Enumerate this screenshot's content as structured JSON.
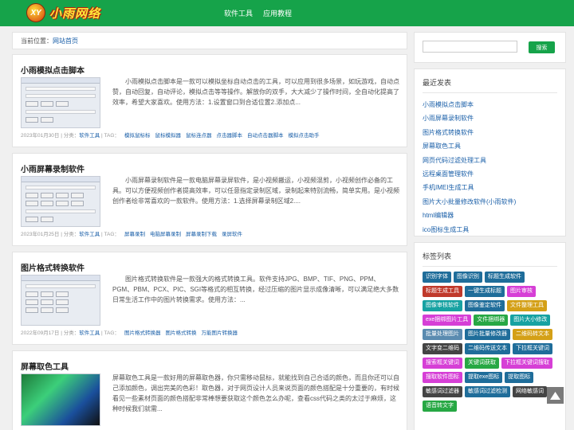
{
  "header": {
    "logo_badge": "XY",
    "logo_text": "小雨网络",
    "nav": [
      "软件工具",
      "应用教程"
    ]
  },
  "breadcrumb": {
    "label": "当前位置：",
    "link": "网站首页"
  },
  "posts": [
    {
      "title": "小雨模拟点击脚本",
      "desc": "小雨模拟点击脚本是一款可以模拟坐标自动点击的工具，可以应用到很多场景，如玩游戏，自动点赞，自动回复，自动评论，模拟点击等等操作。解放你的双手，大大减少了操作时间，全自动化提高了效率，希望大家喜欢。使用方法：1.设置窗口到合适位置2.添加点...",
      "date": "2023年01月30日",
      "cat_label": "分类：",
      "cat": "软件工具",
      "tag_label": "TAG：",
      "tags": [
        "模拟鼠标标",
        "鼠标模拟器",
        "鼠标连点器",
        "点击器脚本",
        "自动点击器脚本",
        "模拟点击助手"
      ]
    },
    {
      "title": "小雨屏幕录制软件",
      "desc": "小雨屏幕录制软件是一款电脑屏幕录屏软件，是小视频搬运，小视频混剪，小视频创作必备的工具。可以方便视频创作者提高效率，可以任意指定录制区域，录制起来特别流畅，简单实用。是小视频创作者绘非常喜欢的一款软件。使用方法：1.选择屏幕录制区域2....",
      "date": "2023年01月25日",
      "cat_label": "分类：",
      "cat": "软件工具",
      "tag_label": "TAG：",
      "tags": [
        "屏幕录制",
        "电脑屏幕录制",
        "屏幕录制下载",
        "录屏软件"
      ]
    },
    {
      "title": "图片格式转换软件",
      "desc": "图片格式转换软件是一款强大的格式转换工具。软件支持JPG、BMP、TIF、PNG、PPM、PGM、PBM、PCX、PIC、SGI等格式的相互转换，经过压缩的图片显示成像清晰，可以满足绝大多数日常生活工作中的图片转换需求。使用方法：...",
      "date": "2022年09月17日",
      "cat_label": "分类：",
      "cat": "软件工具",
      "tag_label": "TAG：",
      "tags": [
        "图片格式转换器",
        "图片格式转换",
        "万能图片转换器"
      ]
    },
    {
      "title": "屏幕取色工具",
      "desc": "屏幕取色工具是一款好用的屏幕取色器，你只需移动鼠标，就能找到自己合适的颜色，而且你还可以自己添加颜色，调出完美的色彩！取色器，对于网页设计人员来说页面的颜色搭配是十分重要的，有时候看见一些素材页面的颜色搭配非常棒想要获取这个颜色怎么办呢，查看css代码之类的太过于麻烦，这种时候我们就需..."
    }
  ],
  "sidebar": {
    "search_button": "搜索",
    "recent_title": "最近发表",
    "recent": [
      "小雨模拟点击脚本",
      "小雨屏幕录制软件",
      "图片格式转换软件",
      "屏幕取色工具",
      "网页代码过滤处理工具",
      "远程桌面管理软件",
      "手机IMEI生成工具",
      "图片大小批量修改软件(小雨软件)",
      "html编辑器",
      "ico图标生成工具"
    ],
    "tags_title": "标签列表",
    "tags": [
      {
        "t": "识别字体",
        "c": "#1f6d9a"
      },
      {
        "t": "图像识别",
        "c": "#1f6d9a"
      },
      {
        "t": "标题生成软件",
        "c": "#1f6d9a"
      },
      {
        "t": "标题生成工具",
        "c": "#c0392b"
      },
      {
        "t": "一键生成标题",
        "c": "#1f6d9a"
      },
      {
        "t": "图片审核",
        "c": "#d63fd6"
      },
      {
        "t": "图像审核软件",
        "c": "#17a2a2"
      },
      {
        "t": "图像鉴定软件",
        "c": "#1f6d9a"
      },
      {
        "t": "文件整理工具",
        "c": "#d4a017"
      },
      {
        "t": "exe捆绑图片工具",
        "c": "#d63fd6"
      },
      {
        "t": "文件捆绑器",
        "c": "#27a844"
      },
      {
        "t": "图片大小修改",
        "c": "#17a2a2"
      },
      {
        "t": "批量处理图片",
        "c": "#5a8bb0"
      },
      {
        "t": "图片批量修改器",
        "c": "#1f6d9a"
      },
      {
        "t": "二维码转文本",
        "c": "#d4a017"
      },
      {
        "t": "文字变二维码",
        "c": "#444444"
      },
      {
        "t": "二维码传送文本",
        "c": "#1f6d9a"
      },
      {
        "t": "下拉框关键词",
        "c": "#1f6d9a"
      },
      {
        "t": "搜索框关键词",
        "c": "#d63fd6"
      },
      {
        "t": "关键词获取",
        "c": "#27a844"
      },
      {
        "t": "下拉框关键词搜取",
        "c": "#d63fd6"
      },
      {
        "t": "搜取软件图标",
        "c": "#d63fd6"
      },
      {
        "t": "提取exe图标",
        "c": "#1f6d9a"
      },
      {
        "t": "提取图标",
        "c": "#1f6d9a"
      },
      {
        "t": "敏感词过滤器",
        "c": "#444444"
      },
      {
        "t": "敏感词过滤检测",
        "c": "#1f6d9a"
      },
      {
        "t": "网络敏感词",
        "c": "#444444"
      },
      {
        "t": "语音转文字",
        "c": "#27a844"
      }
    ]
  },
  "colors": {
    "brand": "#16a34a",
    "link": "#1a5fa8"
  },
  "icons": {
    "back_to_top": "arrow-up-icon"
  }
}
